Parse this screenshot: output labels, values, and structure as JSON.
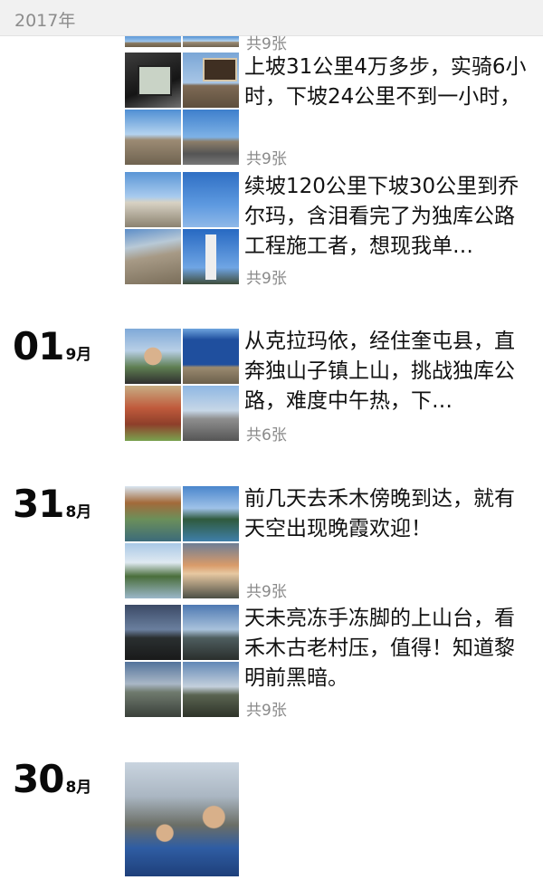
{
  "header": {
    "year": "2017年"
  },
  "posts": [
    {
      "text": "上坡31公里4万多步，实骑6小时，下坡24公里不到一小时，",
      "count": "共9张",
      "thumbs": [
        "device-icon-photo",
        "road-sign-photo",
        "valley-photo",
        "road-photo"
      ]
    },
    {
      "text": "续坡120公里下坡30公里到乔尔玛，含泪看完了为独库公路工程施工者，想现我单…",
      "count": "共9张",
      "thumbs": [
        "gate-photo",
        "blue-sky-photo",
        "cliff-photo",
        "monument-photo"
      ]
    },
    {
      "day": "01",
      "month": "9月",
      "text": "从克拉玛依，经住奎屯县，直奔独山子镇上山，挑战独库公路，难度中午热，下…",
      "count": "共6张",
      "thumbs": [
        "selfie-photo",
        "blue-sign-photo",
        "red-rock-photo",
        "street-photo"
      ]
    },
    {
      "day": "31",
      "month": "8月",
      "text": "前几天去禾木傍晚到达，就有天空出现晚霞欢迎！",
      "count": "共9张",
      "thumbs": [
        "bridge-photo",
        "lake-photo",
        "river-photo",
        "sunset-photo"
      ]
    },
    {
      "text": "天未亮冻手冻脚的上山台，看禾木古老村压，值得！知道黎明前黑暗。",
      "count": "共9张",
      "thumbs": [
        "dusk-photo",
        "dawn-photo",
        "hills-photo",
        "hills2-photo"
      ]
    },
    {
      "day": "30",
      "month": "8月",
      "thumbs": [
        "group-cyclists-photo"
      ]
    }
  ],
  "partial_top": {
    "count": "共9张"
  }
}
